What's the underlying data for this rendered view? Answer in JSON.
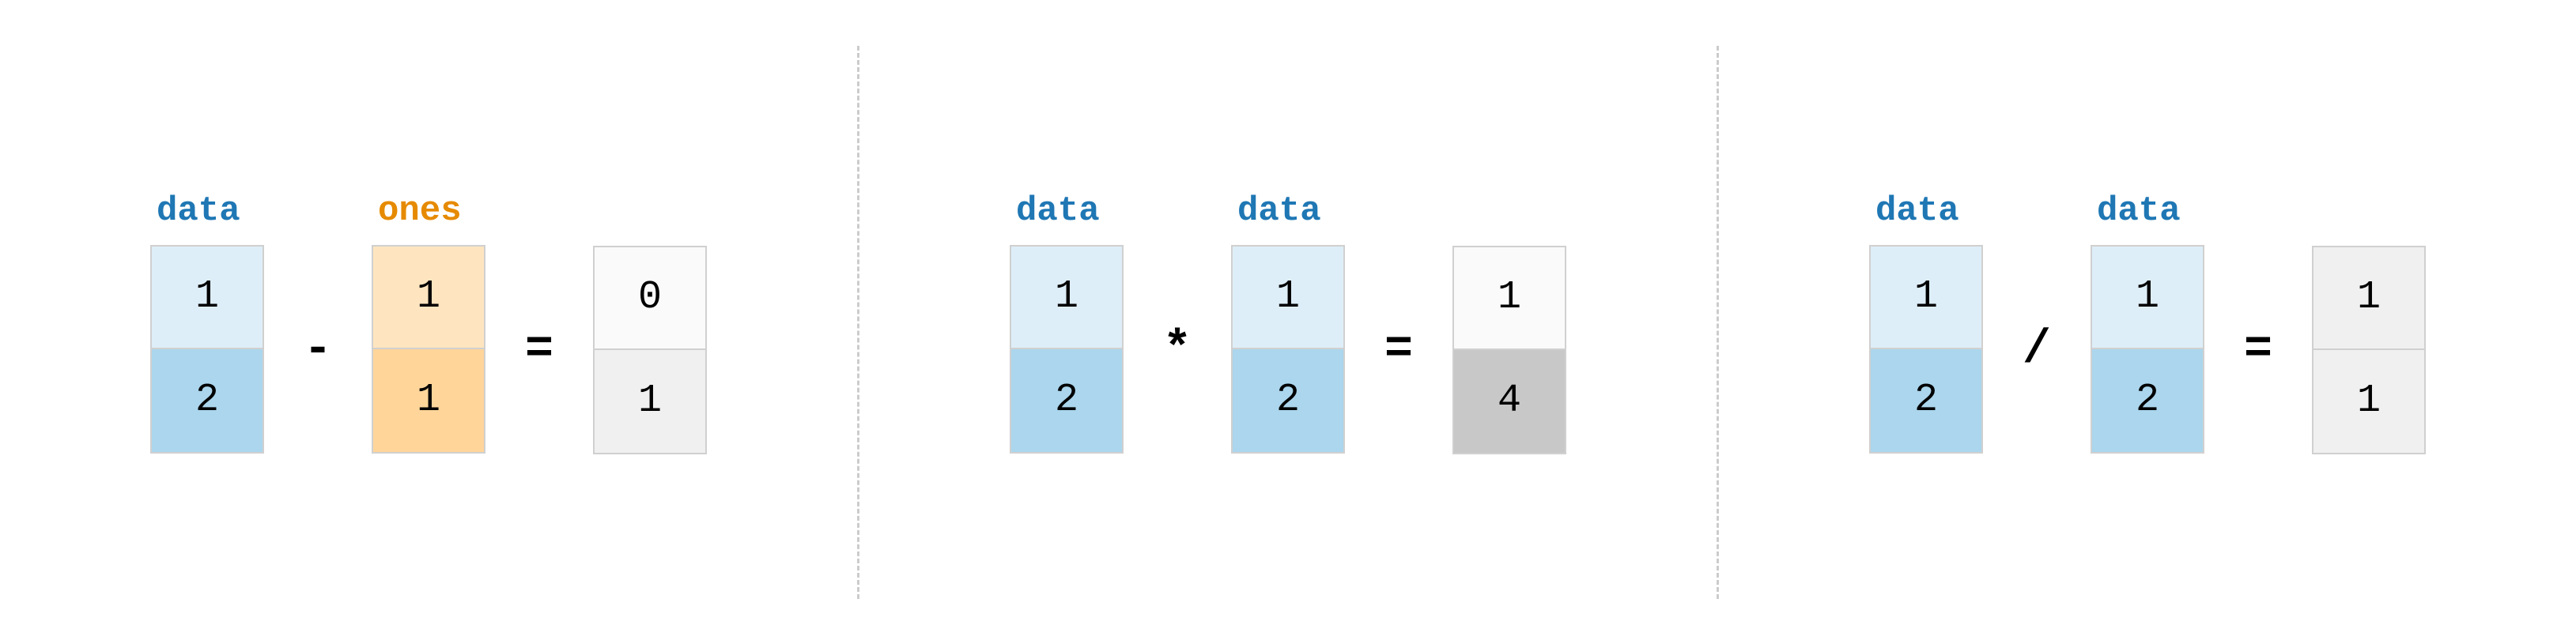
{
  "panels": [
    {
      "operator": "-",
      "operand1": {
        "label": "data",
        "labelColor": "blue",
        "cells": [
          "1",
          "2"
        ],
        "theme": "blue"
      },
      "operand2": {
        "label": "ones",
        "labelColor": "orange",
        "cells": [
          "1",
          "1"
        ],
        "theme": "orange"
      },
      "result": {
        "cells": [
          "0",
          "1"
        ],
        "theme": "gray-simple"
      }
    },
    {
      "operator": "*",
      "operand1": {
        "label": "data",
        "labelColor": "blue",
        "cells": [
          "1",
          "2"
        ],
        "theme": "blue"
      },
      "operand2": {
        "label": "data",
        "labelColor": "blue",
        "cells": [
          "1",
          "2"
        ],
        "theme": "blue"
      },
      "result": {
        "cells": [
          "1",
          "4"
        ],
        "theme": "gray-scaled"
      }
    },
    {
      "operator": "/",
      "operand1": {
        "label": "data",
        "labelColor": "blue",
        "cells": [
          "1",
          "2"
        ],
        "theme": "blue"
      },
      "operand2": {
        "label": "data",
        "labelColor": "blue",
        "cells": [
          "1",
          "2"
        ],
        "theme": "blue"
      },
      "result": {
        "cells": [
          "1",
          "1"
        ],
        "theme": "gray-simple"
      }
    }
  ]
}
